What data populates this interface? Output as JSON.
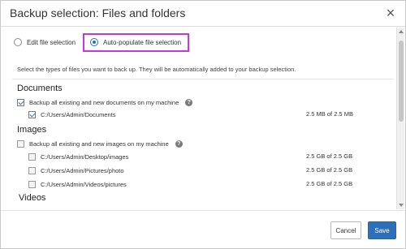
{
  "dialog": {
    "title": "Backup selection: Files and folders",
    "close_glyph": "×"
  },
  "mode": {
    "edit_label": "Edit file selection",
    "auto_label": "Auto-populate file selection",
    "selected": "auto"
  },
  "description": "Select the types of files you want to back up. They will be automatically added to your backup selection.",
  "documents": {
    "title": "Documents",
    "backup_all_label": "Backup all existing and new documents on my machine",
    "backup_all_checked": true,
    "paths": [
      {
        "path": "C:/Users/Admin/Documents",
        "size": "2.5 MB of 2.5 MB",
        "checked": true
      }
    ]
  },
  "images": {
    "title": "Images",
    "backup_all_label": "Backup all existing and new images on my machine",
    "backup_all_checked": false,
    "paths": [
      {
        "path": "C:/Users/Admin/Desktop/images",
        "size": "2.5 GB of 2.5 GB",
        "checked": false
      },
      {
        "path": "C:/Users/Admin/Pictures/photo",
        "size": "2.5 GB of 2.5 GB",
        "checked": false
      },
      {
        "path": "C:/Users/Admin/Videos/pictures",
        "size": "2.5 GB of 2.5 GB",
        "checked": false
      }
    ]
  },
  "videos": {
    "title": "Videos"
  },
  "footer": {
    "cancel_label": "Cancel",
    "save_label": "Save"
  },
  "colors": {
    "accent": "#2c6fbb",
    "highlight": "#c238e0"
  },
  "icons": {
    "help": "help-icon",
    "close": "close-icon"
  }
}
